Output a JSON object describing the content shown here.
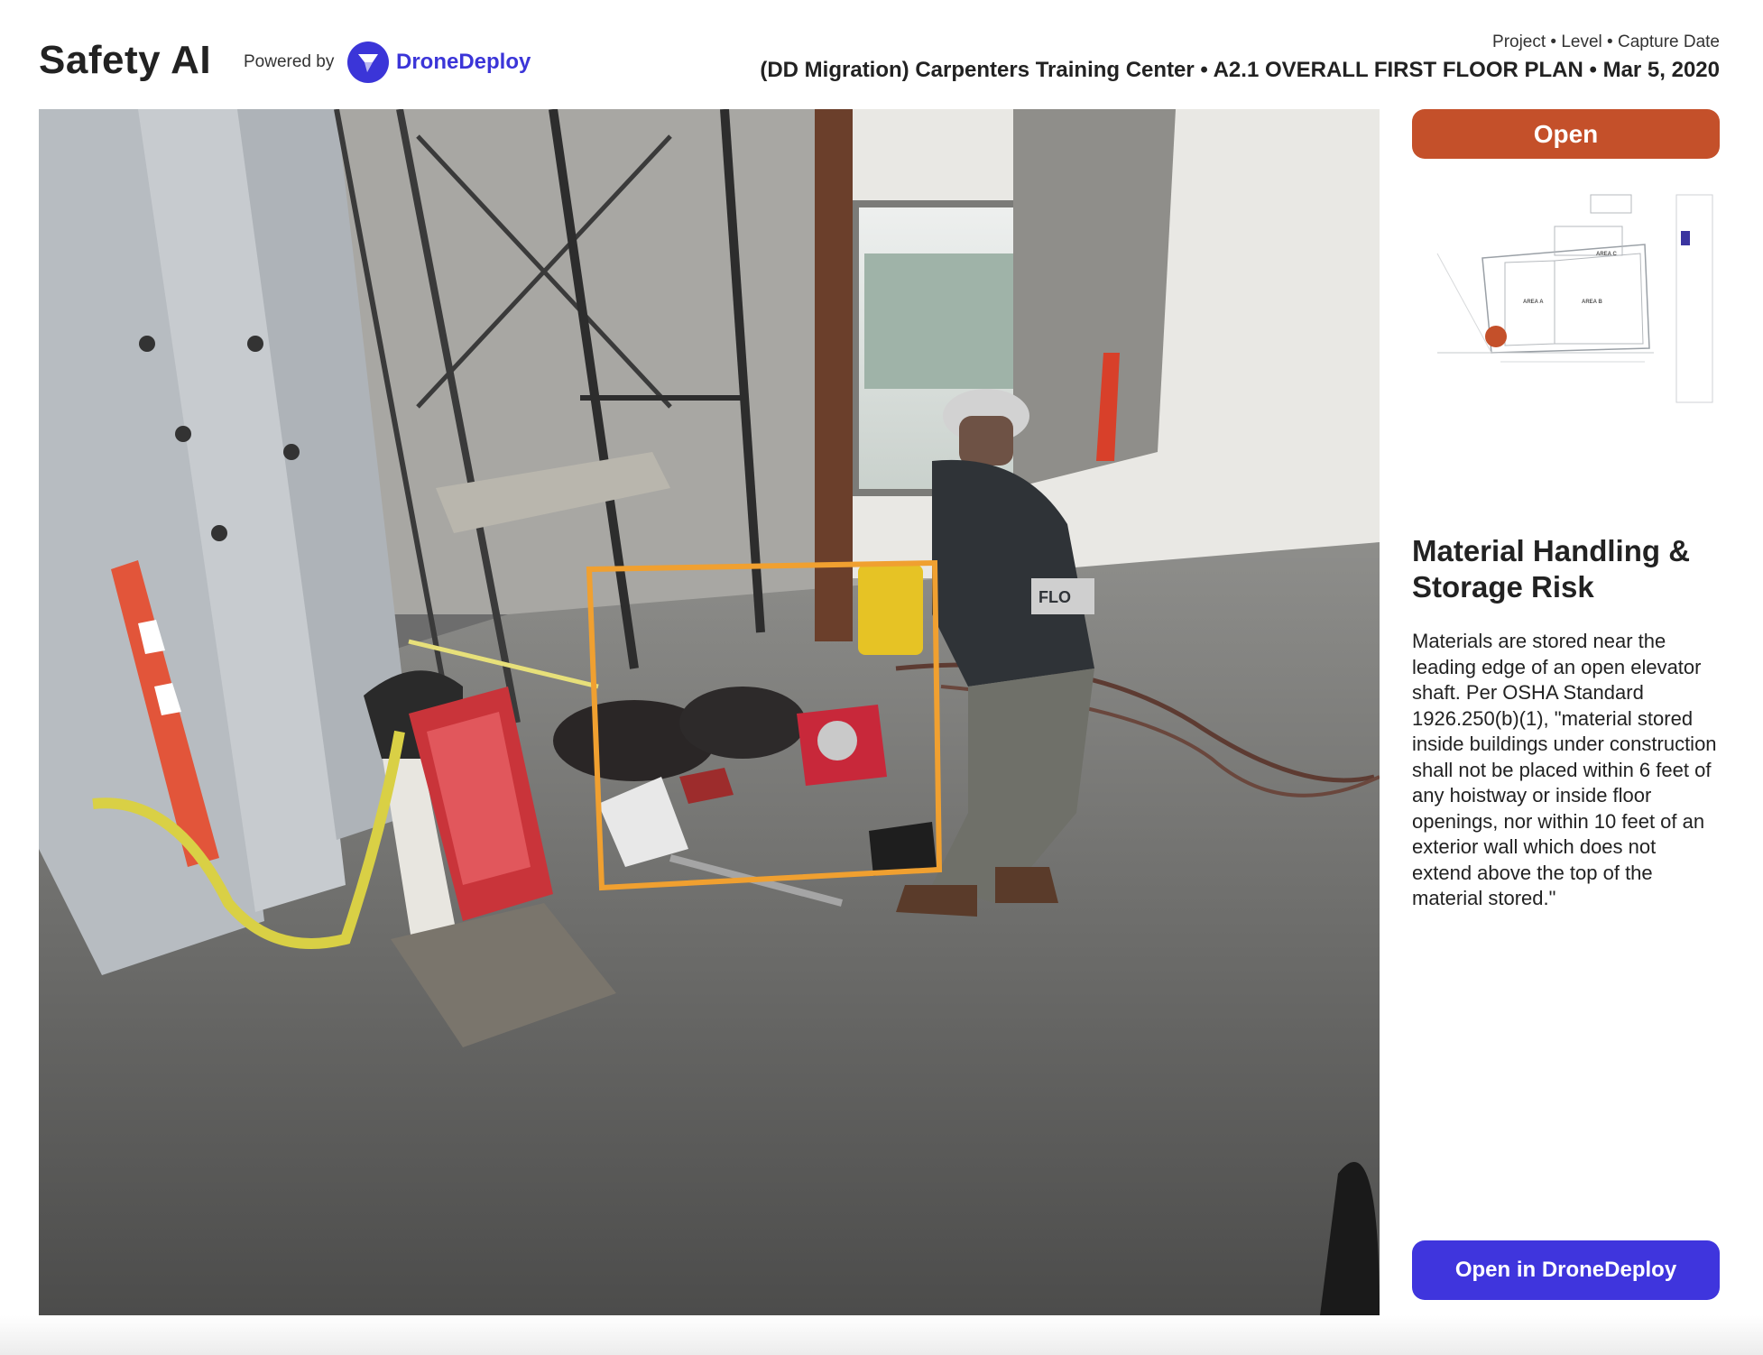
{
  "header": {
    "app_title": "Safety AI",
    "powered_by": "Powered by",
    "brand_name": "DroneDeploy",
    "brand_color": "#3b35d8"
  },
  "meta": {
    "label": "Project • Level • Capture Date",
    "value": "(DD Migration) Carpenters Training Center • A2.1 OVERALL FIRST FLOOR PLAN • Mar 5, 2020"
  },
  "status": {
    "label": "Open",
    "color": "#c4502a"
  },
  "floorplan": {
    "area_labels": [
      "AREA C",
      "AREA A",
      "AREA B"
    ],
    "marker_color": "#c4502a"
  },
  "risk": {
    "title": "Material Handling & Storage Risk",
    "description": "Materials are stored near the leading edge of an open elevator shaft. Per OSHA Standard 1926.250(b)(1), \"material stored inside buildings under construction shall not be placed within 6 feet of any hoistway or inside floor openings, nor within 10 feet of an exterior wall which does not extend above the top of the material stored.\""
  },
  "actions": {
    "open_in_dronedeploy": "Open in DroneDeploy",
    "button_color": "#3f35dd"
  },
  "photo": {
    "highlight_color": "#f0a030",
    "jacket_text": "FLO"
  }
}
